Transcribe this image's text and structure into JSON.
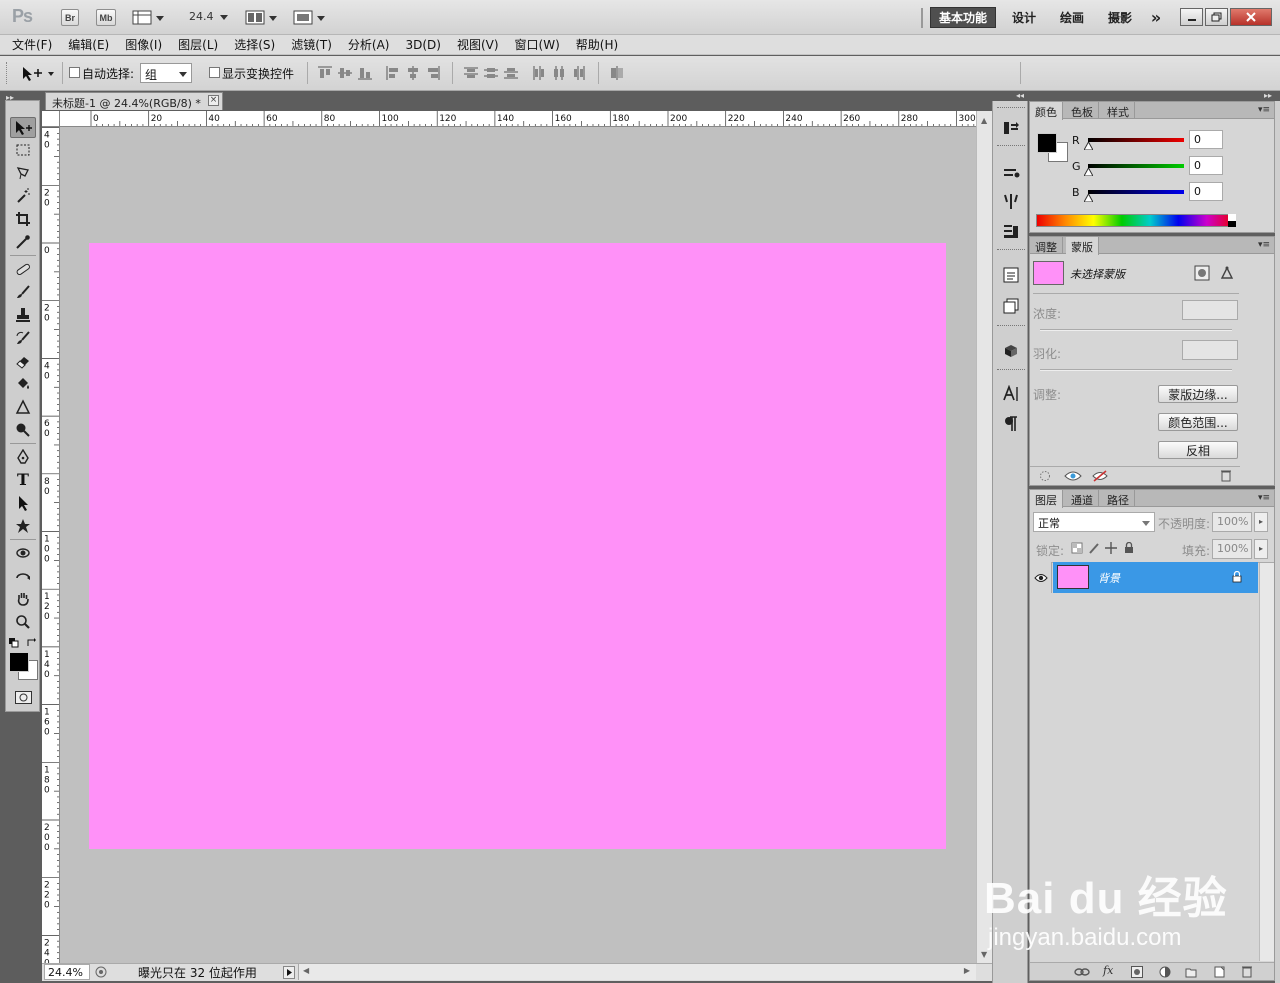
{
  "appbar": {
    "logo": "Ps",
    "bridge_label": "Br",
    "minibridge_label": "Mb",
    "zoom_value": "24.4",
    "workspaces": [
      "基本功能",
      "设计",
      "绘画",
      "摄影"
    ],
    "more_label": "»"
  },
  "menu": [
    "文件(F)",
    "编辑(E)",
    "图像(I)",
    "图层(L)",
    "选择(S)",
    "滤镜(T)",
    "分析(A)",
    "3D(D)",
    "视图(V)",
    "窗口(W)",
    "帮助(H)"
  ],
  "options": {
    "auto_select_label": "自动选择:",
    "auto_select_value": "组",
    "show_transform_label": "显示变换控件"
  },
  "document": {
    "tab_title": "未标题-1 @ 24.4%(RGB/8) *",
    "close_glyph": "×",
    "canvas_color": "#ff91f8",
    "h_ruler_ticks": [
      "0",
      "20",
      "40",
      "60",
      "80",
      "100",
      "120",
      "140",
      "160",
      "180",
      "200",
      "220",
      "240",
      "260",
      "280",
      "300"
    ],
    "v_ruler_ticks": [
      "4 0",
      "2 0",
      "0",
      "2 0",
      "4 0",
      "6 0",
      "8 0",
      "1 0 0",
      "1 2 0",
      "1 4 0",
      "1 6 0",
      "1 8 0",
      "2 0 0",
      "2 2 0",
      "2 4 0"
    ]
  },
  "status": {
    "zoom": "24.4%",
    "message": "曝光只在 32 位起作用"
  },
  "color_panel": {
    "tabs": [
      "颜色",
      "色板",
      "样式"
    ],
    "channels": [
      {
        "label": "R",
        "value": "0"
      },
      {
        "label": "G",
        "value": "0"
      },
      {
        "label": "B",
        "value": "0"
      }
    ]
  },
  "mask_panel": {
    "tabs": [
      "调整",
      "蒙版"
    ],
    "mask_label": "未选择蒙版",
    "density_label": "浓度:",
    "feather_label": "羽化:",
    "refine_label": "调整:",
    "buttons": [
      "蒙版边缘...",
      "颜色范围...",
      "反相"
    ]
  },
  "layers_panel": {
    "tabs": [
      "图层",
      "通道",
      "路径"
    ],
    "blend_mode": "正常",
    "opacity_label": "不透明度:",
    "opacity_value": "100%",
    "lock_label": "锁定:",
    "fill_label": "填充:",
    "fill_value": "100%",
    "layers": [
      {
        "name": "背景",
        "color": "#ff91f8"
      }
    ]
  },
  "watermark": {
    "brand": "Bai du 经验",
    "url": "jingyan.baidu.com"
  }
}
